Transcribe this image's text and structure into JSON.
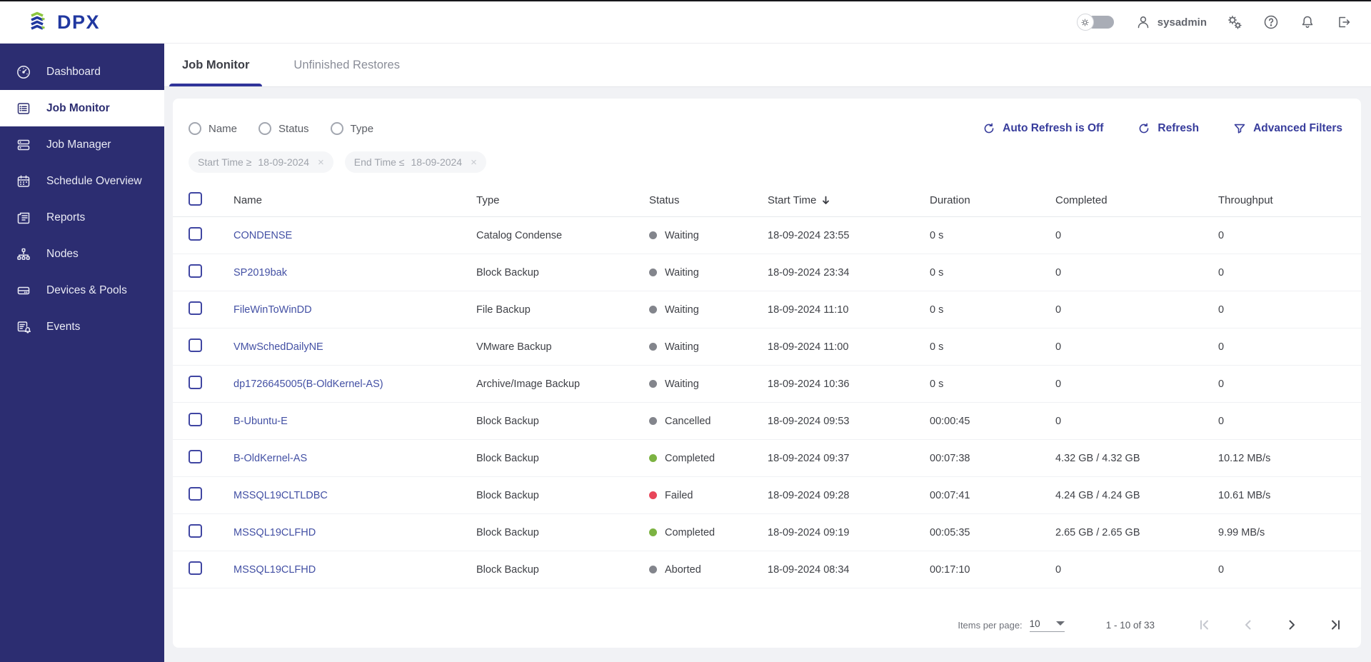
{
  "colors": {
    "gray": "#83858c",
    "green": "#7cb342",
    "red": "#e8465a",
    "accent": "#30349a",
    "sidebar": "#2c2d71"
  },
  "topbar": {
    "logo_text": "DPX",
    "username": "sysadmin"
  },
  "sidebar": {
    "items": [
      {
        "label": "Dashboard",
        "icon": "gauge-icon"
      },
      {
        "label": "Job Monitor",
        "icon": "job-monitor-icon",
        "active": true
      },
      {
        "label": "Job Manager",
        "icon": "job-manager-icon"
      },
      {
        "label": "Schedule Overview",
        "icon": "calendar-icon"
      },
      {
        "label": "Reports",
        "icon": "reports-icon"
      },
      {
        "label": "Nodes",
        "icon": "nodes-icon"
      },
      {
        "label": "Devices & Pools",
        "icon": "devices-icon"
      },
      {
        "label": "Events",
        "icon": "events-icon"
      }
    ]
  },
  "tabs": [
    {
      "label": "Job Monitor",
      "active": true
    },
    {
      "label": "Unfinished Restores",
      "active": false
    }
  ],
  "filters": {
    "radios": [
      "Name",
      "Status",
      "Type"
    ],
    "chips": [
      {
        "label": "Start Time ≥",
        "value": "18-09-2024",
        "close": "×"
      },
      {
        "label": "End Time ≤",
        "value": "18-09-2024",
        "close": "×"
      }
    ],
    "actions": {
      "auto_refresh": "Auto Refresh is Off",
      "refresh": "Refresh",
      "advanced": "Advanced Filters"
    }
  },
  "table": {
    "columns": [
      "Name",
      "Type",
      "Status",
      "Start Time",
      "Duration",
      "Completed",
      "Throughput"
    ],
    "rows": [
      {
        "name": "CONDENSE",
        "type": "Catalog Condense",
        "status": "Waiting",
        "status_color": "gray",
        "start": "18-09-2024 23:55",
        "duration": "0 s",
        "completed": "0",
        "throughput": "0"
      },
      {
        "name": "SP2019bak",
        "type": "Block Backup",
        "status": "Waiting",
        "status_color": "gray",
        "start": "18-09-2024 23:34",
        "duration": "0 s",
        "completed": "0",
        "throughput": "0"
      },
      {
        "name": "FileWinToWinDD",
        "type": "File Backup",
        "status": "Waiting",
        "status_color": "gray",
        "start": "18-09-2024 11:10",
        "duration": "0 s",
        "completed": "0",
        "throughput": "0"
      },
      {
        "name": "VMwSchedDailyNE",
        "type": "VMware Backup",
        "status": "Waiting",
        "status_color": "gray",
        "start": "18-09-2024 11:00",
        "duration": "0 s",
        "completed": "0",
        "throughput": "0"
      },
      {
        "name": "dp1726645005(B-OldKernel-AS)",
        "type": "Archive/Image Backup",
        "status": "Waiting",
        "status_color": "gray",
        "start": "18-09-2024 10:36",
        "duration": "0 s",
        "completed": "0",
        "throughput": "0"
      },
      {
        "name": "B-Ubuntu-E",
        "type": "Block Backup",
        "status": "Cancelled",
        "status_color": "gray",
        "start": "18-09-2024 09:53",
        "duration": "00:00:45",
        "completed": "0",
        "throughput": "0"
      },
      {
        "name": "B-OldKernel-AS",
        "type": "Block Backup",
        "status": "Completed",
        "status_color": "green",
        "start": "18-09-2024 09:37",
        "duration": "00:07:38",
        "completed": "4.32 GB / 4.32 GB",
        "throughput": "10.12 MB/s"
      },
      {
        "name": "MSSQL19CLTLDBC",
        "type": "Block Backup",
        "status": "Failed",
        "status_color": "red",
        "start": "18-09-2024 09:28",
        "duration": "00:07:41",
        "completed": "4.24 GB / 4.24 GB",
        "throughput": "10.61 MB/s"
      },
      {
        "name": "MSSQL19CLFHD",
        "type": "Block Backup",
        "status": "Completed",
        "status_color": "green",
        "start": "18-09-2024 09:19",
        "duration": "00:05:35",
        "completed": "2.65 GB / 2.65 GB",
        "throughput": "9.99 MB/s"
      },
      {
        "name": "MSSQL19CLFHD",
        "type": "Block Backup",
        "status": "Aborted",
        "status_color": "gray",
        "start": "18-09-2024 08:34",
        "duration": "00:17:10",
        "completed": "0",
        "throughput": "0"
      }
    ]
  },
  "pagination": {
    "items_per_page_label": "Items per page:",
    "items_per_page": "10",
    "range": "1 - 10 of 33"
  }
}
